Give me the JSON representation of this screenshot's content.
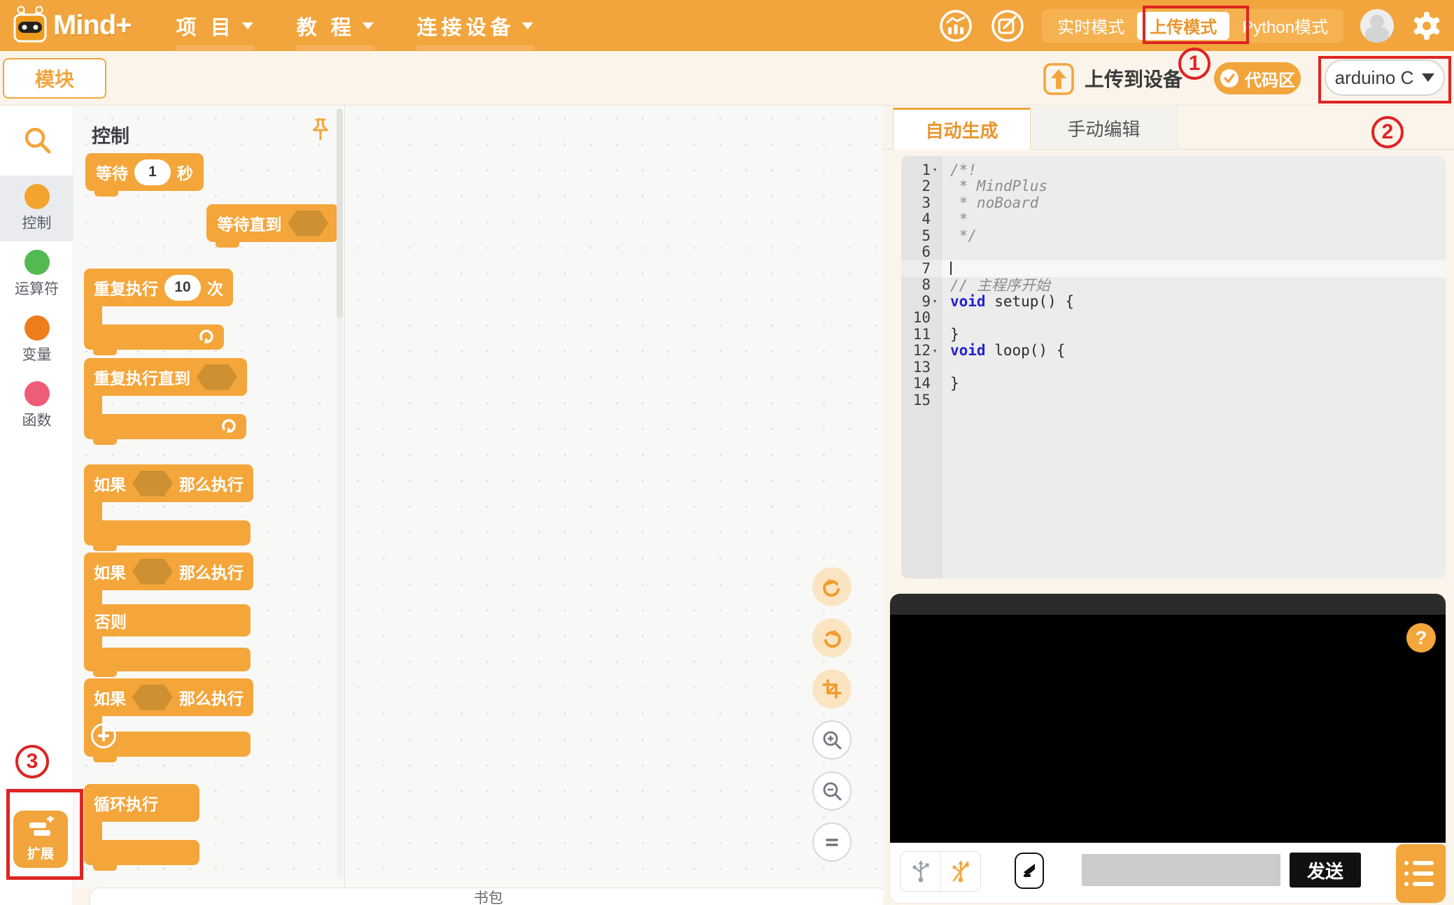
{
  "topbar": {
    "brand": "Mind+",
    "menus": [
      {
        "label": "项 目"
      },
      {
        "label": "教 程"
      },
      {
        "label": "连接设备"
      }
    ],
    "modes": {
      "realtime": "实时模式",
      "upload": "上传模式",
      "python": "Python模式"
    },
    "accent_color": "#F2A53C"
  },
  "subbar": {
    "module_tab": "模块",
    "upload_label": "上传到设备",
    "code_area_label": "代码区",
    "board_value": "arduino C"
  },
  "sidebar": {
    "categories": [
      {
        "label": "控制",
        "color": "#F3A42F",
        "selected": true
      },
      {
        "label": "运算符",
        "color": "#53B951",
        "selected": false
      },
      {
        "label": "变量",
        "color": "#EF7E1A",
        "selected": false
      },
      {
        "label": "函数",
        "color": "#EE5C78",
        "selected": false
      }
    ],
    "extensions_label": "扩展"
  },
  "palette": {
    "header": "控制",
    "block_color": "#F4A63B",
    "boolean_slot_color": "#CE9030",
    "blocks": {
      "wait": {
        "pre": "等待",
        "value": "1",
        "post": "秒"
      },
      "wait_until": {
        "label": "等待直到"
      },
      "repeat": {
        "pre": "重复执行",
        "value": "10",
        "post": "次"
      },
      "repeat_until": {
        "label": "重复执行直到"
      },
      "if1": {
        "pre": "如果",
        "post": "那么执行"
      },
      "if2": {
        "pre": "如果",
        "post": "那么执行",
        "else_label": "否则"
      },
      "if3": {
        "pre": "如果",
        "post": "那么执行"
      },
      "forever": {
        "label": "循环执行"
      }
    }
  },
  "code_panel": {
    "tabs": [
      "自动生成",
      "手动编辑"
    ],
    "lines": [
      {
        "n": "1",
        "fold": true,
        "segs": [
          {
            "t": "/*!",
            "c": "cm"
          }
        ]
      },
      {
        "n": "2",
        "fold": false,
        "segs": [
          {
            "t": " * MindPlus",
            "c": "cm"
          }
        ]
      },
      {
        "n": "3",
        "fold": false,
        "segs": [
          {
            "t": " * noBoard",
            "c": "cm"
          }
        ]
      },
      {
        "n": "4",
        "fold": false,
        "segs": [
          {
            "t": " *",
            "c": "cm"
          }
        ]
      },
      {
        "n": "5",
        "fold": false,
        "segs": [
          {
            "t": " */",
            "c": "cm"
          }
        ]
      },
      {
        "n": "6",
        "fold": false,
        "segs": []
      },
      {
        "n": "7",
        "fold": false,
        "cursor": true,
        "highlight": true,
        "segs": []
      },
      {
        "n": "8",
        "fold": false,
        "segs": [
          {
            "t": "// 主程序开始",
            "c": "cm"
          }
        ]
      },
      {
        "n": "9",
        "fold": true,
        "segs": [
          {
            "t": "void",
            "c": "kw"
          },
          {
            "t": " setup() {",
            "c": "pl"
          }
        ]
      },
      {
        "n": "10",
        "fold": false,
        "segs": []
      },
      {
        "n": "11",
        "fold": false,
        "segs": [
          {
            "t": "}",
            "c": "pl"
          }
        ]
      },
      {
        "n": "12",
        "fold": true,
        "segs": [
          {
            "t": "void",
            "c": "kw"
          },
          {
            "t": " loop() {",
            "c": "pl"
          }
        ]
      },
      {
        "n": "13",
        "fold": false,
        "segs": []
      },
      {
        "n": "14",
        "fold": false,
        "segs": [
          {
            "t": "}",
            "c": "pl"
          }
        ]
      },
      {
        "n": "15",
        "fold": false,
        "segs": []
      }
    ]
  },
  "serial": {
    "send_label": "发送",
    "help_label": "?"
  },
  "footer": {
    "bag_label": "书包"
  },
  "annotations": {
    "n1": "1",
    "n2": "2",
    "n3": "3",
    "color": "#DE2424"
  },
  "icons": {
    "community-icon": "circle with bar chart",
    "compose-icon": "circle with square and pencil",
    "gear-icon": "settings gear",
    "avatar": "user silhouette",
    "upload-icon": "arrow up in rounded square",
    "check-icon": "white circle with orange check",
    "search-icon": "magnifier",
    "pin-icon": "pushpin",
    "extensions-icon": "blocks with plus",
    "undo-icon": "counterclockwise arrow",
    "redo-icon": "clockwise arrow",
    "crop-icon": "crop frame",
    "zoom-in-icon": "magnifier plus",
    "zoom-out-icon": "magnifier minus",
    "zoom-reset-icon": "equals sign",
    "loop-arrow-icon": "repeat arrow",
    "usb-connected-icon": "gray usb trident",
    "usb-disconnected-icon": "orange usb trident with slash",
    "clear-icon": "black clear console glyph",
    "list-icon": "white list lines with dots",
    "help-icon": "question mark"
  }
}
